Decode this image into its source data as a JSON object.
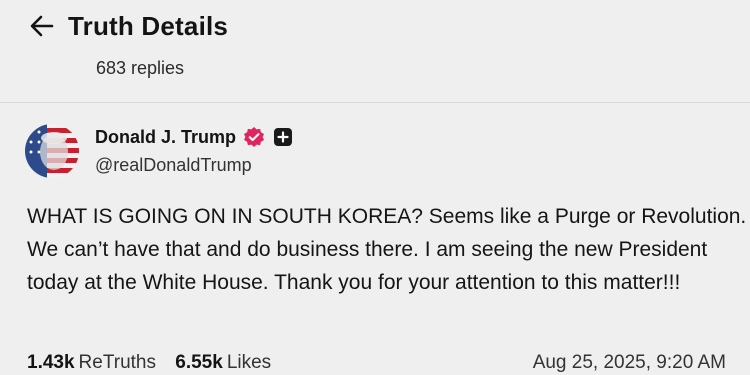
{
  "header": {
    "title": "Truth Details",
    "replies": "683 replies",
    "back_icon": "arrow-left-icon"
  },
  "author": {
    "name": "Donald J. Trump",
    "handle": "@realDonaldTrump",
    "verified_icon": "verified-badge-icon",
    "verified_color": "#e0245e",
    "follow_icon": "plus-icon"
  },
  "post": {
    "text": "WHAT IS GOING ON IN SOUTH KOREA? Seems like a Purge or Revolution. We can’t have that and do business there. I am seeing the new President today at the White House. Thank you for your attention to this matter!!!"
  },
  "stats": {
    "retruths_count": "1.43k",
    "retruths_label": "ReTruths",
    "likes_count": "6.55k",
    "likes_label": "Likes",
    "timestamp": "Aug 25, 2025, 9:20 AM"
  }
}
